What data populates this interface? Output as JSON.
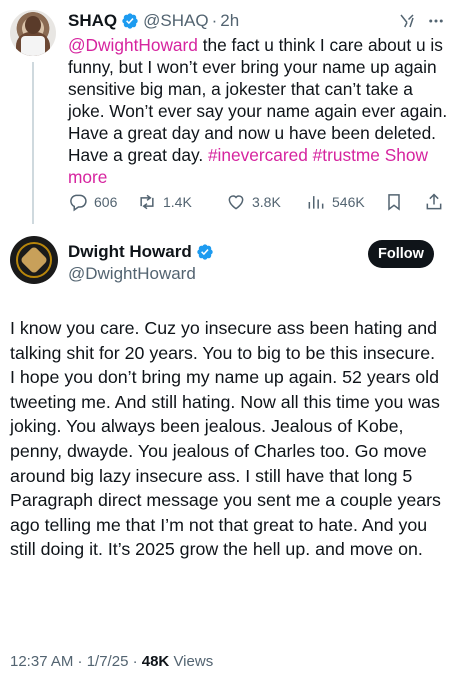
{
  "parent_tweet": {
    "name": "SHAQ",
    "handle": "@SHAQ",
    "separator": "·",
    "time": "2h",
    "text_mention": "@DwightHoward",
    "text_body": " the fact u think I care about u is funny, but I won’t ever bring your name up again sensitive big man, a jokester that can’t take a joke. Won’t ever say your name again ever again. Have a great day and now u have been deleted. Have a great day. ",
    "hashtag_1": "#inevercared",
    "hashtag_2": "#trustme",
    "show_more": "Show more",
    "actions": {
      "replies": "606",
      "reposts": "1.4K",
      "likes": "3.8K",
      "views": "546K"
    }
  },
  "main_tweet": {
    "name": "Dwight Howard",
    "handle": "@DwightHoward",
    "follow_label": "Follow",
    "text": "I know you care. Cuz yo insecure ass been hating and talking shit for 20 years. You to big to be this insecure.  I hope you don’t bring my name up again.  52 years old tweeting me.  And still hating. Now all this time you was joking.  You always been jealous.  Jealous of Kobe, penny, dwayde.  You jealous of Charles too.  Go move around big lazy insecure ass.  I still have that long 5 Paragraph direct message you sent me a couple years ago telling me that I’m not that great to hate. And you still doing it. It’s 2025 grow the hell up. and move on.",
    "timestamp": "12:37 AM · 1/7/25 · ",
    "views_count": "48K",
    "views_label": " Views"
  },
  "colors": {
    "accent_pink": "#d6249f",
    "verified_blue": "#1d9bf0",
    "text_primary": "#0f1419",
    "text_secondary": "#536471"
  },
  "icons": [
    "verified-badge-icon",
    "grok-icon",
    "more-icon",
    "reply-icon",
    "repost-icon",
    "like-icon",
    "views-icon",
    "bookmark-icon",
    "share-icon"
  ]
}
